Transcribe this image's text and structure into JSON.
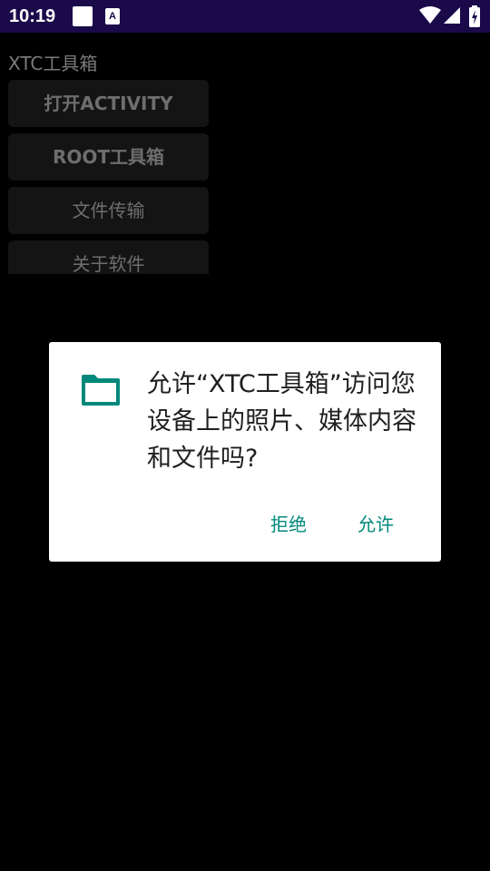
{
  "status_bar": {
    "time": "10:19",
    "notification_letter": "A",
    "icons": [
      "notification-square-icon",
      "notification-a-icon",
      "wifi-icon",
      "signal-icon",
      "battery-charging-icon"
    ]
  },
  "app": {
    "title": "XTC工具箱",
    "buttons": [
      {
        "label": "打开ACTIVITY"
      },
      {
        "label": "ROOT工具箱"
      },
      {
        "label": "文件传输"
      },
      {
        "label": "关于软件"
      }
    ]
  },
  "dialog": {
    "icon": "folder-icon",
    "message": "允许“XTC工具箱”访问您设备上的照片、媒体内容和文件吗?",
    "deny_label": "拒绝",
    "allow_label": "允许",
    "accent_color": "#00897b"
  },
  "colors": {
    "status_bar_bg": "#1a0a4a",
    "background": "#000000",
    "dialog_bg": "#ffffff",
    "accent": "#00897b"
  }
}
